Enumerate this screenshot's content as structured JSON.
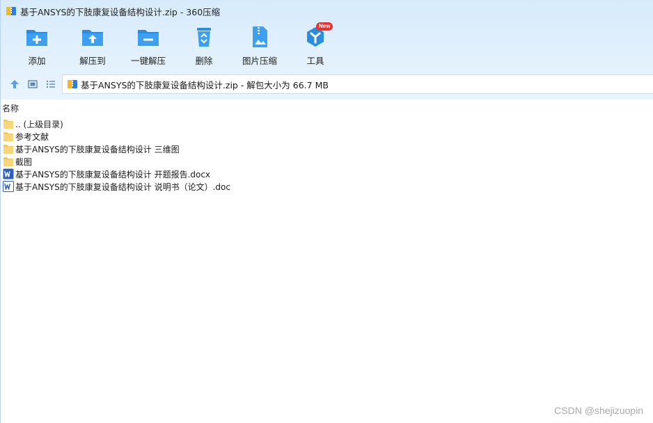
{
  "window": {
    "title": "基于ANSYS的下肢康复设备结构设计.zip - 360压缩"
  },
  "toolbar": {
    "items": [
      {
        "label": "添加",
        "icon": "folder-add-icon"
      },
      {
        "label": "解压到",
        "icon": "folder-extract-icon"
      },
      {
        "label": "一键解压",
        "icon": "folder-oneclick-icon"
      },
      {
        "label": "删除",
        "icon": "recycle-bin-icon"
      },
      {
        "label": "图片压缩",
        "icon": "image-compress-icon"
      },
      {
        "label": "工具",
        "icon": "tools-icon",
        "badge": "New"
      }
    ]
  },
  "navbar": {
    "address": "基于ANSYS的下肢康复设备结构设计.zip - 解包大小为 66.7 MB"
  },
  "list": {
    "header_name": "名称",
    "items": [
      {
        "name": ".. (上级目录)",
        "type": "folder"
      },
      {
        "name": "参考文献",
        "type": "folder"
      },
      {
        "name": "基于ANSYS的下肢康复设备结构设计 三维图",
        "type": "folder"
      },
      {
        "name": "截图",
        "type": "folder"
      },
      {
        "name": "基于ANSYS的下肢康复设备结构设计 开题报告.docx",
        "type": "docx"
      },
      {
        "name": "基于ANSYS的下肢康复设备结构设计 说明书（论文）.doc",
        "type": "doc"
      }
    ]
  },
  "watermark": "CSDN @shejizuopin",
  "colors": {
    "accent": "#2a8de0",
    "folder": "#f7d77a",
    "word_blue": "#2b5fc4",
    "badge": "#e8322f"
  }
}
